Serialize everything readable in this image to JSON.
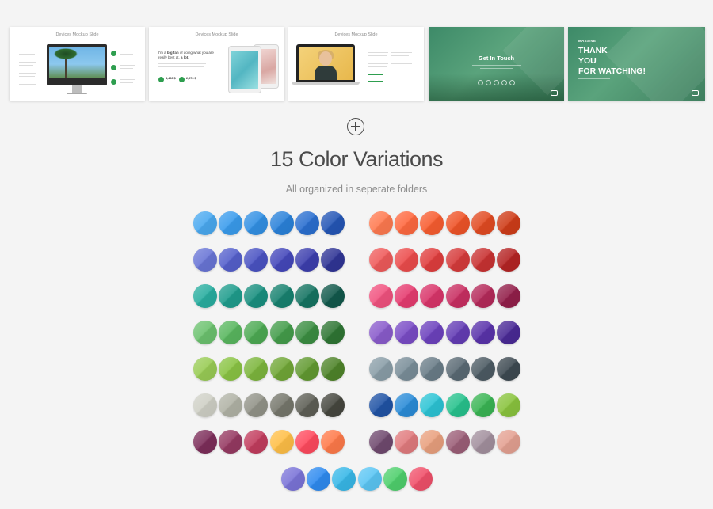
{
  "slides": [
    {
      "title": "Devices Mockup Slide"
    },
    {
      "title": "Devices Mockup Slide",
      "headline_start": "I'm a ",
      "headline_bold": "big fan",
      "headline_mid": " of doing what you are",
      "headline_line2_start": "really best at, ",
      "headline_line2_bold": "a lot",
      "headline_line2_end": ".",
      "stat1": "3,456 $",
      "stat2": "2,674 $"
    },
    {
      "title": "Devices Mockup Slide"
    },
    {
      "title": "Get In Touch"
    },
    {
      "small_label": "MASSIVE",
      "line1": "THANK",
      "line2": "YOU",
      "line3": "FOR WATCHING!"
    }
  ],
  "heading": "15 Color Variations",
  "subheading": "All organized in seperate folders",
  "colors": {
    "left": [
      [
        "#4aa9f0",
        "#3a9ced",
        "#3290e4",
        "#2a82da",
        "#2a6fd0",
        "#2456b6"
      ],
      [
        "#6975d6",
        "#5560cc",
        "#4a53c3",
        "#4548bb",
        "#3d3fae",
        "#303596"
      ],
      [
        "#29aea0",
        "#1f9d8d",
        "#1a9080",
        "#188270",
        "#157462",
        "#12594c"
      ],
      [
        "#6cc26f",
        "#59b75f",
        "#4daa53",
        "#449d4b",
        "#3b8e42",
        "#2f7634"
      ],
      [
        "#99cc55",
        "#8ac444",
        "#7db63d",
        "#71a737",
        "#629a31",
        "#4f842a"
      ],
      [
        "#cfd0c6",
        "#b1b3a6",
        "#929388",
        "#76776c",
        "#5e5f56",
        "#46473f"
      ],
      [
        "#7d2e5a",
        "#963a62",
        "#c23d5e",
        "#ffbf47",
        "#ff4a5e",
        "#ff7a4a"
      ]
    ],
    "right": [
      [
        "#ff7a50",
        "#ff6940",
        "#f85d30",
        "#ef5428",
        "#e24b22",
        "#cf3d19"
      ],
      [
        "#ef5b5b",
        "#ec4c4c",
        "#e03e3e",
        "#d63b3b",
        "#c93232",
        "#b52424"
      ],
      [
        "#f1527f",
        "#e63c70",
        "#d9356a",
        "#c92f62",
        "#b52a5a",
        "#931f4a"
      ],
      [
        "#8a5ccc",
        "#7a4cc6",
        "#6d42be",
        "#643db5",
        "#5a33ab",
        "#4a2a96"
      ],
      [
        "#8a9ea8",
        "#7a8e99",
        "#6a7d88",
        "#5a6a74",
        "#4d5b64",
        "#3e4a52"
      ],
      [
        "#2053a5",
        "#2b8cd8",
        "#2cc4d5",
        "#27c28d",
        "#3ab554",
        "#8ac43e"
      ],
      [
        "#704a6f",
        "#e17b7e",
        "#e9a07e",
        "#9c5f78",
        "#a3909e",
        "#e4a192"
      ]
    ],
    "bottom": [
      "#7b74d8",
      "#2f8bf0",
      "#38b8e8",
      "#5bc6f4",
      "#4fd06d",
      "#f0506a"
    ]
  }
}
